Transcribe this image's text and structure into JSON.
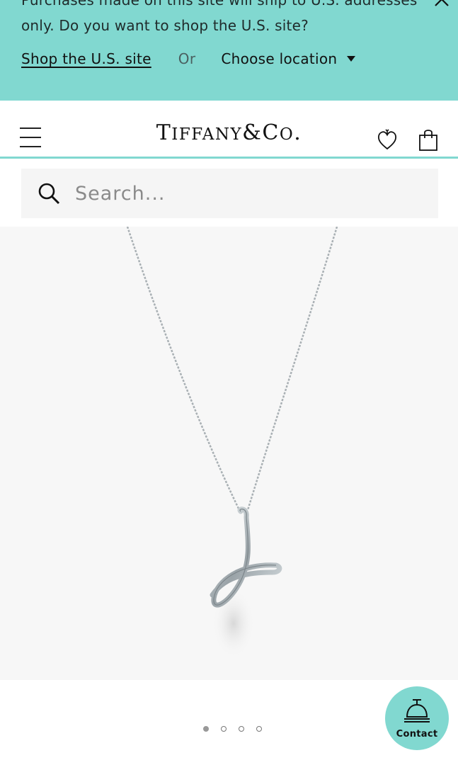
{
  "banner": {
    "line1": "Purchases made on this site will ship to U.S. addresses",
    "line2": "only. Do you want to shop the U.S. site?",
    "shop_us_label": "Shop the U.S. site",
    "or_label": "Or",
    "choose_location_label": "Choose location",
    "close_icon": "close-icon"
  },
  "header": {
    "logo_text": "Tiffany & Co.",
    "menu_icon": "hamburger-icon",
    "wishlist_icon": "heart-icon",
    "bag_icon": "shopping-bag-icon"
  },
  "search": {
    "placeholder": "Search...",
    "icon": "search-icon"
  },
  "gallery": {
    "image_count": 4,
    "active_index": 0
  },
  "contact": {
    "label": "Contact",
    "icon": "service-bell-icon"
  },
  "colors": {
    "accent": "#81d8d0",
    "text": "#1a1a1a"
  }
}
